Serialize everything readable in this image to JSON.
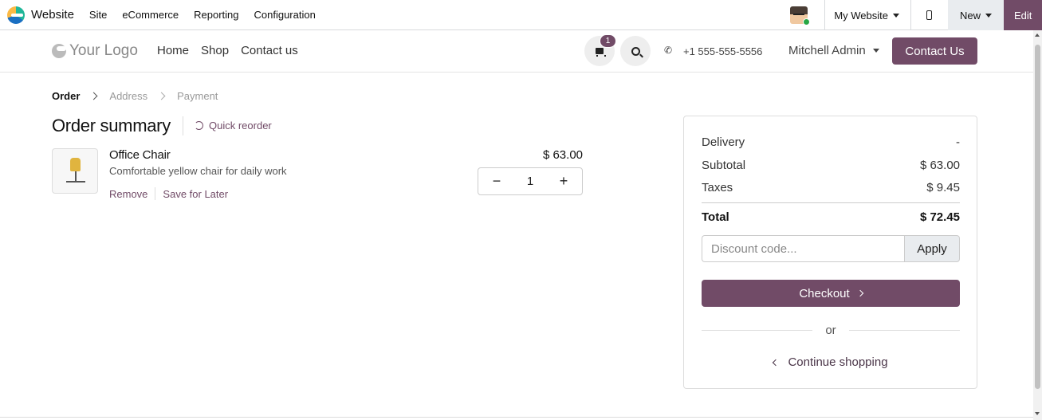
{
  "admin": {
    "brand": "Website",
    "menu": [
      "Site",
      "eCommerce",
      "Reporting",
      "Configuration"
    ],
    "my_website": "My Website",
    "new_label": "New",
    "edit_label": "Edit"
  },
  "header": {
    "logo": "Your Logo",
    "nav": [
      "Home",
      "Shop",
      "Contact us"
    ],
    "cart_count": "1",
    "phone": "+1 555-555-5556",
    "user": "Mitchell Admin",
    "contact_button": "Contact Us"
  },
  "breadcrumb": [
    "Order",
    "Address",
    "Payment"
  ],
  "order": {
    "title": "Order summary",
    "quick_reorder": "Quick reorder",
    "product": {
      "name": "Office Chair",
      "description": "Comfortable yellow chair for daily work",
      "remove": "Remove",
      "save_later": "Save for Later",
      "price": "$ 63.00",
      "quantity": "1",
      "minus": "−",
      "plus": "+"
    }
  },
  "summary": {
    "delivery_label": "Delivery",
    "delivery_value": "-",
    "subtotal_label": "Subtotal",
    "subtotal_value": "$ 63.00",
    "taxes_label": "Taxes",
    "taxes_value": "$ 9.45",
    "total_label": "Total",
    "total_value": "$ 72.45",
    "discount_placeholder": "Discount code...",
    "apply": "Apply",
    "checkout": "Checkout",
    "or": "or",
    "continue": "Continue shopping"
  },
  "colors": {
    "primary": "#714b67"
  }
}
